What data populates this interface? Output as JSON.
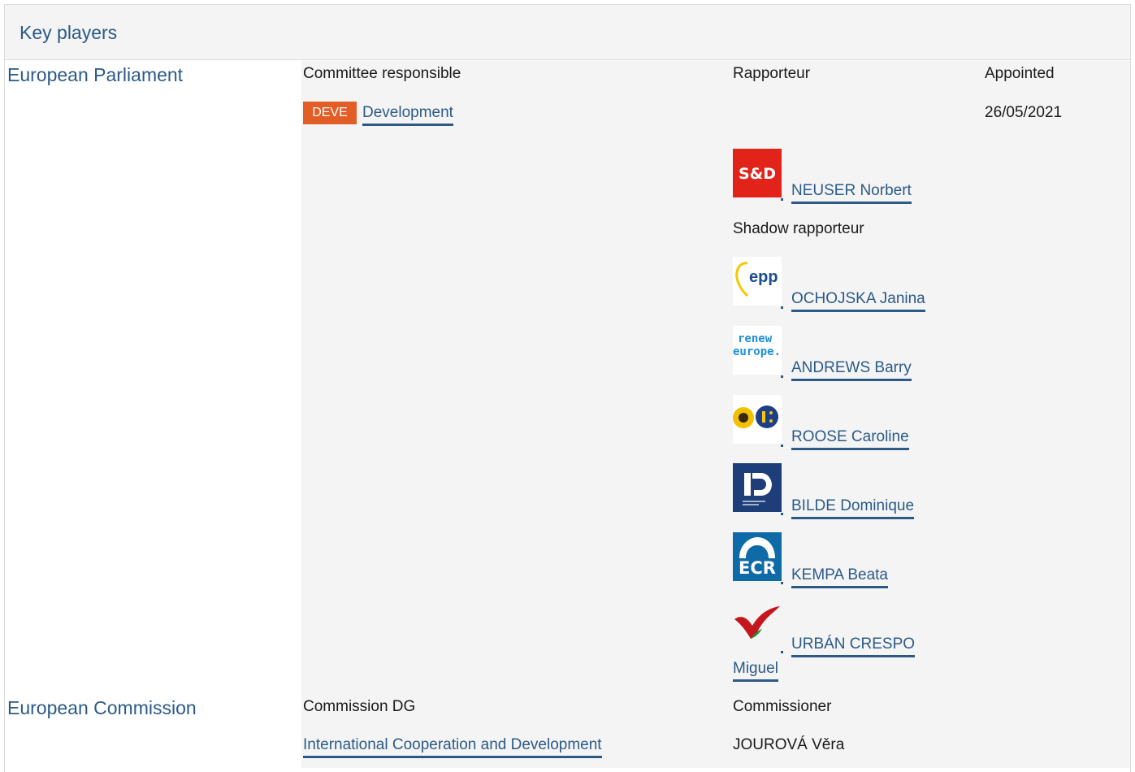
{
  "section": {
    "title": "Key players"
  },
  "parliament": {
    "institution": "European Parliament",
    "committee_header": "Committee responsible",
    "rapporteur_header": "Rapporteur",
    "appointed_header": "Appointed",
    "committee_code": "DEVE",
    "committee_name": "Development",
    "appointed_date": "26/05/2021",
    "rapporteur": {
      "group_logo": "S&D",
      "name": "NEUSER Norbert"
    },
    "shadow_header": "Shadow rapporteur",
    "shadows": [
      {
        "group_logo": "epp",
        "name": "OCHOJSKA Janina"
      },
      {
        "group_logo_line1": "renew",
        "group_logo_line2": "europe.",
        "name": "ANDREWS Barry"
      },
      {
        "group_logo": "greens-efa-logo",
        "name": "ROOSE Caroline"
      },
      {
        "group_logo": "identity-democracy-logo",
        "name": "BILDE Dominique"
      },
      {
        "group_logo": "ECR",
        "name": "KEMPA Beata"
      },
      {
        "group_logo": "gue-ngl-logo",
        "name_line1": "URBÁN CRESPO",
        "name_line2": "Miguel"
      }
    ]
  },
  "commission": {
    "institution": "European Commission",
    "dg_header": "Commission DG",
    "commissioner_header": "Commissioner",
    "dg_name": "International Cooperation and Development",
    "commissioner": "JOUROVÁ Věra"
  },
  "colors": {
    "link": "#2b5a87",
    "deve_badge": "#e35e26",
    "sd_red": "#e2231a",
    "id_navy": "#1d3e78",
    "ecr_blue": "#0f6ba8"
  }
}
